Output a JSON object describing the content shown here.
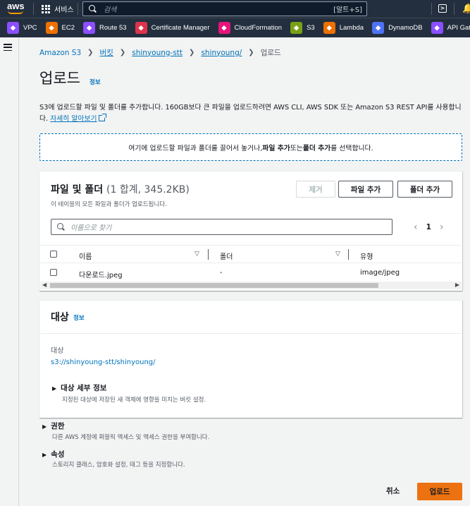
{
  "topnav": {
    "logo": "aws",
    "services_label": "서비스",
    "search_placeholder": "검색",
    "search_shortcut": "[알트+S]"
  },
  "favorites": [
    {
      "label": "VPC",
      "color": "#8c4fff",
      "icon": "vpc-icon"
    },
    {
      "label": "EC2",
      "color": "#ed7100",
      "icon": "ec2-icon"
    },
    {
      "label": "Route 53",
      "color": "#8c4fff",
      "icon": "route53-icon"
    },
    {
      "label": "Certificate Manager",
      "color": "#dd344c",
      "icon": "certificate-manager-icon"
    },
    {
      "label": "CloudFormation",
      "color": "#e7157b",
      "icon": "cloudformation-icon"
    },
    {
      "label": "S3",
      "color": "#7aa116",
      "icon": "s3-icon"
    },
    {
      "label": "Lambda",
      "color": "#ed7100",
      "icon": "lambda-icon"
    },
    {
      "label": "DynamoDB",
      "color": "#4d72f3",
      "icon": "dynamodb-icon"
    },
    {
      "label": "API Gateway",
      "color": "#8c4fff",
      "icon": "api-gateway-icon"
    }
  ],
  "breadcrumb": {
    "items": [
      "Amazon S3",
      "버킷",
      "shinyoung-stt",
      "shinyoung/"
    ],
    "current": "업로드"
  },
  "page": {
    "title": "업로드",
    "info": "정보",
    "description_pre": "S3에 업로드할 파일 및 폴더를 추가합니다. 160GB보다 큰 파일을 업로드하려면 AWS CLI, AWS SDK 또는 Amazon S3 REST API를 사용합니다.",
    "learn_more": "자세히 알아보기",
    "dropzone_pre": "여기에 업로드할 파일과 폴더를 끌어서 놓거나, ",
    "dropzone_b1": "파일 추가",
    "dropzone_mid": " 또는 ",
    "dropzone_b2": "폴더 추가",
    "dropzone_post": "를 선택합니다."
  },
  "files_panel": {
    "title": "파일 및 폴더",
    "count": "(1 합계, 345.2KB)",
    "subtitle": "이 테이블의 모든 파일과 폴더가 업로드됩니다.",
    "remove_button": "제거",
    "add_files_button": "파일 추가",
    "add_folder_button": "폴더 추가",
    "filter_placeholder": "이름으로 찾기",
    "page": "1",
    "columns": [
      "이름",
      "폴더",
      "유형"
    ],
    "rows": [
      {
        "name": "다운로드.jpeg",
        "folder": "-",
        "type": "image/jpeg"
      }
    ]
  },
  "destination": {
    "title": "대상",
    "info": "정보",
    "label": "대상",
    "path": "s3://shinyoung-stt/shinyoung/",
    "details_title": "대상 세부 정보",
    "details_desc": "지정된 대상에 저장된 새 객체에 영향을 미치는 버킷 설정."
  },
  "permissions": {
    "title": "권한",
    "desc": "다른 AWS 계정에 퍼블릭 액세스 및 액세스 권한을 부여합니다."
  },
  "properties": {
    "title": "속성",
    "desc": "스토리지 클래스, 암호화 설정, 태그 등을 지정합니다."
  },
  "footer": {
    "cancel": "취소",
    "upload": "업로드"
  }
}
